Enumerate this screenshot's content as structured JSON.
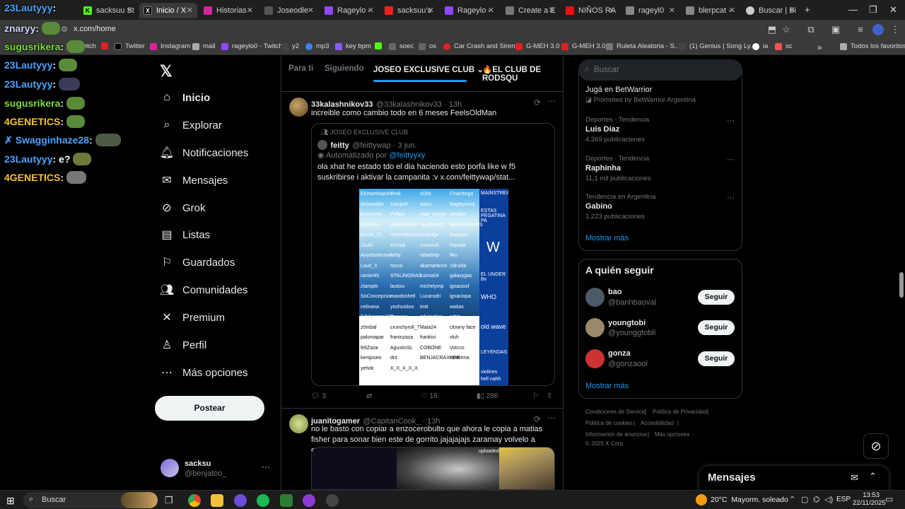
{
  "browser": {
    "tabs": [
      {
        "label": "sacksuu St",
        "active": false
      },
      {
        "label": "Inicio / X",
        "active": true
      },
      {
        "label": "Historias -",
        "active": false
      },
      {
        "label": "Joseodle",
        "active": false
      },
      {
        "label": "Rageylo -",
        "active": false
      },
      {
        "label": "sacksuu's",
        "active": false
      },
      {
        "label": "Rageylo -",
        "active": false
      },
      {
        "label": "Create a E",
        "active": false
      },
      {
        "label": "NIÑOS RA",
        "active": false
      },
      {
        "label": "rageyl0",
        "active": false
      },
      {
        "label": "blerpcat -",
        "active": false
      },
      {
        "label": "Buscar | Bi",
        "active": false
      }
    ],
    "new_tab": "+",
    "url": "x.com/home",
    "bookmarks": [
      "Twitch",
      "Twitter",
      "Instagram",
      "mail",
      "rageylo0 - Twitch",
      "y2",
      "mp3",
      "key bpm",
      "",
      "soec",
      "os",
      "Car Crash and Siren...",
      "G-MEH 3.0",
      "G-MEH 3.0",
      "Ruleta Aleatoria - S...",
      "(1) Genius | Song Ly...",
      "ia",
      "sc"
    ],
    "bookmarks_more": "»",
    "all_bookmarks": "Todos los favoritos"
  },
  "chat": [
    {
      "user": "23Lautyyy",
      "color": "#4aa3ff"
    },
    {
      "user": "znaryy",
      "color": "#cfd8ff"
    },
    {
      "user": "sugusrikera",
      "color": "#7ddc3e"
    },
    {
      "user": "23Lautyyy",
      "color": "#4aa3ff"
    },
    {
      "user": "23Lautyyy",
      "color": "#4aa3ff"
    },
    {
      "user": "sugusrikera",
      "color": "#7ddc3e"
    },
    {
      "user": "4GENETICS",
      "color": "#f6c12a"
    },
    {
      "user": "Swagginhaze28",
      "color": "#4aa3ff",
      "badge": "✗"
    },
    {
      "user": "23Lautyyy",
      "color": "#4aa3ff",
      "text": "e?"
    },
    {
      "user": "4GENETICS",
      "color": "#f6c12a"
    }
  ],
  "sidebar": {
    "logo": "𝕏",
    "items": [
      {
        "label": "Inicio",
        "icon": "home-icon"
      },
      {
        "label": "Explorar",
        "icon": "search-icon"
      },
      {
        "label": "Notificaciones",
        "icon": "bell-icon"
      },
      {
        "label": "Mensajes",
        "icon": "mail-icon"
      },
      {
        "label": "Grok",
        "icon": "grok-icon"
      },
      {
        "label": "Listas",
        "icon": "list-icon"
      },
      {
        "label": "Guardados",
        "icon": "bookmark-icon"
      },
      {
        "label": "Comunidades",
        "icon": "people-icon"
      },
      {
        "label": "Premium",
        "icon": "x-icon"
      },
      {
        "label": "Perfil",
        "icon": "person-icon"
      },
      {
        "label": "Más opciones",
        "icon": "more-icon"
      }
    ],
    "post_button": "Postear",
    "account": {
      "name": "sacksu",
      "handle": "@benjatoo_",
      "more": "···"
    }
  },
  "feed": {
    "tabs": [
      "Para ti",
      "Siguiendo",
      "JOSEO EXCLUSIVE CLUB",
      "🔥EL CLUB DE RODSQU"
    ],
    "tweet1": {
      "name": "33kalashnikov33",
      "handle": "@33kalashnikov33 · 13h",
      "text": "increible como cambio todo en 6 meses FeelsOldMan",
      "quote": {
        "community": "JOSEO EXCLUSIVE CLUB",
        "name": "feitty",
        "handle": "@feittywap · 3 jun.",
        "automated_prefix": "Automatizado por",
        "automated_by": "@feittyyxy",
        "text": "ola xhat he estado tdo el dia haciendo esto porfa like w f5 suskribirse i aktivar la campanita :v  x.com/feittywap/stat..."
      },
      "iceberg": {
        "left_words": [
          "Elchambapolo",
          "Yesk",
          "zDhk",
          "Chachingo",
          "doomaddo",
          "Xianjinfr",
          "solxu",
          "Bagleyssiol",
          "kyommeii",
          "Pefaur",
          "mart_peepo",
          "zmattyy",
          "333briza",
          "dealetdelbal",
          "NicoZero02",
          "BAKKKR00MS",
          "bautix_21",
          "mercedessoa",
          "zzzanga",
          "basqiato",
          "Juuliii",
          "Kichab",
          "crossrob",
          "Ripside",
          "Anyelunknown",
          "feitty",
          "rafaelotp",
          "fiku",
          "Lauti_3",
          "rocca",
          "akamartinnn",
          "1druida",
          "ramirr45",
          "STALINGRAD",
          "kutma04",
          "galaxygas",
          "ztample",
          "lautixu",
          "michelymp",
          "ignaciosf",
          "SoConcepcion",
          "maxdoshell",
          "Lucarodri",
          "ignaciopa",
          "celinana",
          "yoshusitoo",
          "tmtt",
          "watias",
          "Edsheeran190_",
          "dmsazu",
          "edutactico",
          "rubia",
          "z0mbal",
          "crunchyroll_7",
          "Maia24",
          "clowny face",
          "palomapar",
          "franinzaza",
          "frankivi",
          "vluh",
          "feliZaza",
          "AgustinSL",
          "COBONE",
          "Volcco",
          "kenijoseo",
          "dnt",
          "BENJACRAXKER",
          "ramtirma",
          "yehok",
          "X_X_X_X_X"
        ],
        "right_words": [
          "MAINSTREAM",
          "ESTAS PEGATINA PA",
          "W",
          "EL UNDER Bv",
          "WHO",
          "old wave",
          "LEYENDAS",
          "violines",
          "hell nahh"
        ]
      },
      "actions": {
        "reply": "3",
        "retweet": "",
        "like": "16",
        "views": "286"
      }
    },
    "tweet2": {
      "name": "juanitogamer",
      "handle": "@CapitanCook_ · 13h",
      "text": "no le basto con copiar a enzocerobulto que ahora le copia a matias fisher para sonar bien este de gorrito jajajajajs zaramay volvelo a enterrar porfavor",
      "media_label": "uploaded"
    }
  },
  "right": {
    "search_placeholder": "Buscar",
    "promo": {
      "title": "Jugá en BetWarrior",
      "sub": "Promoted by BetWarrior Argentina"
    },
    "trends": [
      {
        "meta": "Deportes · Tendencia",
        "title": "Luis Díaz",
        "count": "4.369 publicaciones"
      },
      {
        "meta": "Deportes · Tendencia",
        "title": "Raphinha",
        "count": "11,1 mil publicaciones"
      },
      {
        "meta": "Tendencia en Argentina",
        "title": "Gabino",
        "count": "1.223 publicaciones"
      }
    ],
    "show_more": "Mostrar más",
    "who_to_follow": {
      "title": "A quién seguir",
      "users": [
        {
          "name": "bao",
          "handle": "@banhbaoval"
        },
        {
          "name": "youngtobi",
          "handle": "@younggtobli"
        },
        {
          "name": "gonza",
          "handle": "@gonzaool"
        }
      ],
      "follow_label": "Seguir",
      "show_more": "Mostrar más"
    },
    "footer": [
      "Condiciones de Servicio",
      "Política de Privacidad",
      "Política de cookies",
      "Accesibilidad",
      "Información de anuncios",
      "Más opciones ···",
      "© 2025 X Corp."
    ],
    "messages_label": "Mensajes"
  },
  "taskbar": {
    "search_label": "Buscar",
    "weather_temp": "20°C",
    "weather_text": "Mayorm. soleado",
    "lang": "ESP",
    "time": "13:53",
    "date": "22/11/2025"
  },
  "colors": {
    "accent": "#1d9bf0",
    "bg": "#000000",
    "border": "#2f3336",
    "muted": "#71767b"
  }
}
